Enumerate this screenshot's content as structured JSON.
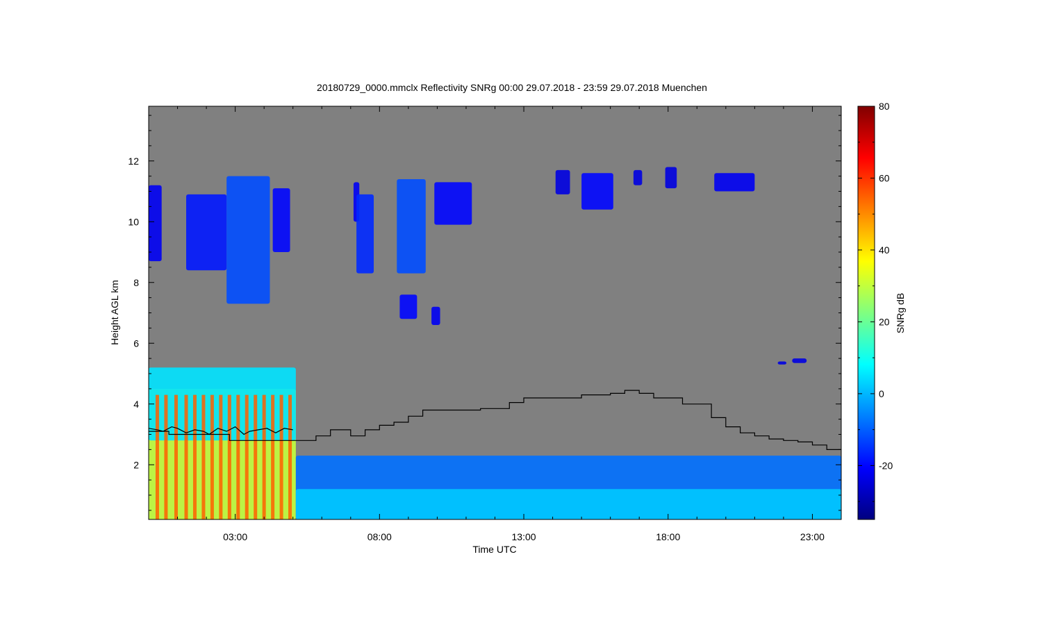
{
  "chart_data": {
    "type": "heatmap",
    "title": "20180729_0000.mmclx Reflectivity SNRg   00:00 29.07.2018 - 23:59 29.07.2018 Muenchen",
    "xlabel": "Time UTC",
    "ylabel": "Height AGL km",
    "xlim": [
      0,
      24
    ],
    "ylim": [
      0.2,
      13.8
    ],
    "x_ticks": [
      {
        "value": 3,
        "label": "03:00"
      },
      {
        "value": 8,
        "label": "08:00"
      },
      {
        "value": 13,
        "label": "13:00"
      },
      {
        "value": 18,
        "label": "18:00"
      },
      {
        "value": 23,
        "label": "23:00"
      }
    ],
    "y_ticks": [
      {
        "value": 2,
        "label": "2"
      },
      {
        "value": 4,
        "label": "4"
      },
      {
        "value": 6,
        "label": "6"
      },
      {
        "value": 8,
        "label": "8"
      },
      {
        "value": 10,
        "label": "10"
      },
      {
        "value": 12,
        "label": "12"
      }
    ],
    "background_color": "#808080",
    "colorbar": {
      "label": "SNRg dB",
      "range": [
        -35,
        80
      ],
      "ticks": [
        {
          "value": 80,
          "label": "80"
        },
        {
          "value": 60,
          "label": "60"
        },
        {
          "value": 40,
          "label": "40"
        },
        {
          "value": 20,
          "label": "20"
        },
        {
          "value": 0,
          "label": "0"
        },
        {
          "value": -20,
          "label": "-20"
        }
      ],
      "colormap": [
        "#000080",
        "#0000ff",
        "#0080ff",
        "#00ffff",
        "#80ff80",
        "#ffff00",
        "#ff8000",
        "#ff0000",
        "#800000"
      ]
    },
    "echo_regions": [
      {
        "x0": 0.0,
        "x1": 0.45,
        "y0": 8.7,
        "y1": 11.2,
        "snr": -22
      },
      {
        "x0": 1.3,
        "x1": 2.7,
        "y0": 8.4,
        "y1": 10.9,
        "snr": -18
      },
      {
        "x0": 2.7,
        "x1": 4.2,
        "y0": 7.3,
        "y1": 11.5,
        "snr": -12
      },
      {
        "x0": 4.3,
        "x1": 4.9,
        "y0": 9.0,
        "y1": 11.1,
        "snr": -20
      },
      {
        "x0": 7.1,
        "x1": 7.3,
        "y0": 10.0,
        "y1": 11.3,
        "snr": -22
      },
      {
        "x0": 7.2,
        "x1": 7.8,
        "y0": 8.3,
        "y1": 10.9,
        "snr": -16
      },
      {
        "x0": 8.6,
        "x1": 9.6,
        "y0": 8.3,
        "y1": 11.4,
        "snr": -12
      },
      {
        "x0": 8.7,
        "x1": 9.3,
        "y0": 6.8,
        "y1": 7.6,
        "snr": -20
      },
      {
        "x0": 9.8,
        "x1": 10.1,
        "y0": 6.6,
        "y1": 7.2,
        "snr": -22
      },
      {
        "x0": 9.9,
        "x1": 11.2,
        "y0": 9.9,
        "y1": 11.3,
        "snr": -20
      },
      {
        "x0": 14.1,
        "x1": 14.6,
        "y0": 10.9,
        "y1": 11.7,
        "snr": -24
      },
      {
        "x0": 15.0,
        "x1": 16.1,
        "y0": 10.4,
        "y1": 11.6,
        "snr": -20
      },
      {
        "x0": 16.8,
        "x1": 17.1,
        "y0": 11.2,
        "y1": 11.7,
        "snr": -24
      },
      {
        "x0": 17.9,
        "x1": 18.3,
        "y0": 11.1,
        "y1": 11.8,
        "snr": -24
      },
      {
        "x0": 19.6,
        "x1": 21.0,
        "y0": 11.0,
        "y1": 11.6,
        "snr": -22
      },
      {
        "x0": 21.8,
        "x1": 22.1,
        "y0": 5.3,
        "y1": 5.4,
        "snr": -24
      },
      {
        "x0": 22.3,
        "x1": 22.8,
        "y0": 5.35,
        "y1": 5.5,
        "snr": -24
      },
      {
        "x0": 0.0,
        "x1": 5.1,
        "y0": 0.2,
        "y1": 4.5,
        "snr": 30
      },
      {
        "x0": 0.0,
        "x1": 5.1,
        "y0": 2.8,
        "y1": 5.2,
        "snr": 5
      },
      {
        "x0": 5.1,
        "x1": 24.0,
        "y0": 0.2,
        "y1": 2.3,
        "snr": -8
      },
      {
        "x0": 5.1,
        "x1": 24.0,
        "y0": 0.2,
        "y1": 1.2,
        "snr": 2
      }
    ],
    "precip_columns_x": [
      0.3,
      0.6,
      0.95,
      1.3,
      1.6,
      1.9,
      2.2,
      2.5,
      2.8,
      3.1,
      3.4,
      3.7,
      4.0,
      4.3,
      4.6,
      4.9
    ],
    "series": [
      {
        "x": [
          0.0,
          0.3,
          0.5,
          0.8,
          1.0,
          1.3,
          1.6,
          1.9,
          2.1,
          2.4,
          2.7,
          3.0,
          3.3,
          3.5,
          3.8,
          4.1,
          4.4,
          4.7,
          5.0
        ],
        "y": [
          3.2,
          3.15,
          3.1,
          3.25,
          3.2,
          3.05,
          3.15,
          3.1,
          3.0,
          3.2,
          3.1,
          3.25,
          3.0,
          3.1,
          3.15,
          3.2,
          3.05,
          3.2,
          3.15
        ]
      },
      {
        "x": [
          0.0,
          0.7,
          0.7,
          2.8,
          2.8,
          5.8,
          5.8,
          6.3,
          6.3,
          7.0,
          7.0,
          7.5,
          7.5,
          8.0,
          8.0,
          8.5,
          8.5,
          9.0,
          9.0,
          9.5,
          9.5,
          11.5,
          11.5,
          12.5,
          12.5,
          13.0,
          13.0,
          15.0,
          15.0,
          16.0,
          16.0,
          16.5,
          16.5,
          17.0,
          17.0,
          17.5,
          17.5,
          18.5,
          18.5,
          19.5,
          19.5,
          20.0,
          20.0,
          20.5,
          20.5,
          21.0,
          21.0,
          21.5,
          21.5,
          22.0,
          22.0,
          22.5,
          22.5,
          23.0,
          23.0,
          23.5,
          23.5,
          24.0
        ],
        "y": [
          3.1,
          3.1,
          3.0,
          3.0,
          2.8,
          2.8,
          2.95,
          2.95,
          3.15,
          3.15,
          2.95,
          2.95,
          3.15,
          3.15,
          3.3,
          3.3,
          3.4,
          3.4,
          3.6,
          3.6,
          3.8,
          3.8,
          3.85,
          3.85,
          4.05,
          4.05,
          4.2,
          4.2,
          4.3,
          4.3,
          4.35,
          4.35,
          4.45,
          4.45,
          4.35,
          4.35,
          4.2,
          4.2,
          4.0,
          4.0,
          3.55,
          3.55,
          3.25,
          3.25,
          3.05,
          3.05,
          2.95,
          2.95,
          2.85,
          2.85,
          2.8,
          2.8,
          2.75,
          2.75,
          2.65,
          2.65,
          2.5,
          2.5
        ]
      }
    ]
  }
}
